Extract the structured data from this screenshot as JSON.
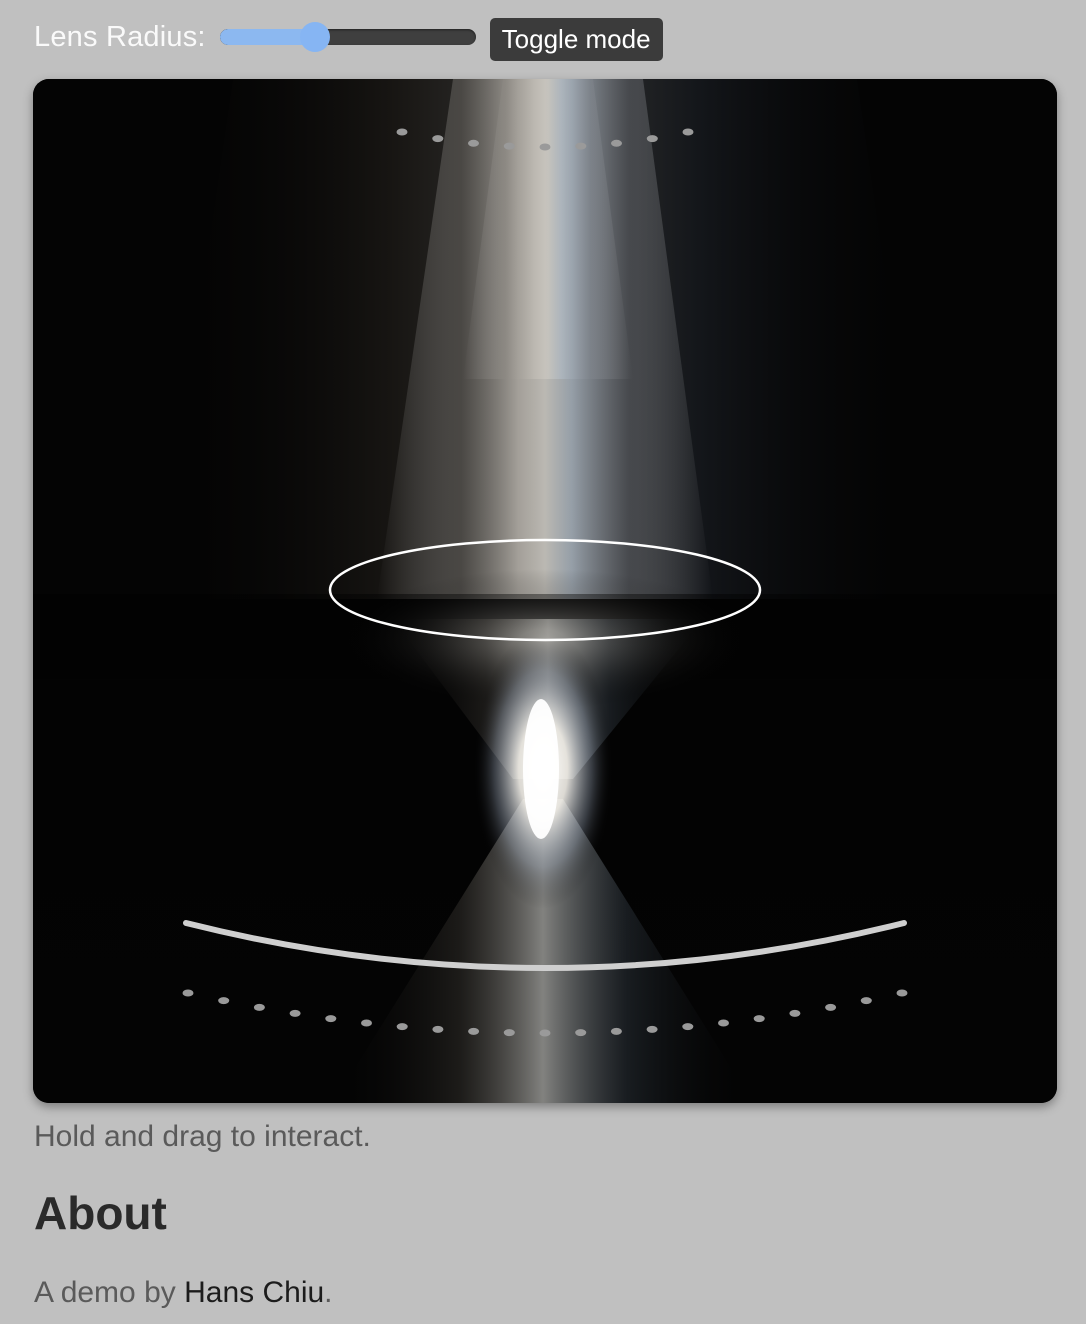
{
  "controls": {
    "lens_radius_label": "Lens Radius:",
    "lens_radius_level": 0.37,
    "toggle_label": "Toggle mode"
  },
  "canvas": {
    "top_dots": 9,
    "bottom_dots": 21
  },
  "colors": {
    "page_background": "#c0c0c0",
    "slider_accent": "#86b5f3",
    "button_background": "#3b3b3b",
    "canvas_background": "#050505"
  },
  "hint": "Hold and drag to interact.",
  "about": {
    "heading": "About",
    "credit_prefix": "A demo by ",
    "author": "Hans Chiu",
    "credit_suffix": "."
  }
}
